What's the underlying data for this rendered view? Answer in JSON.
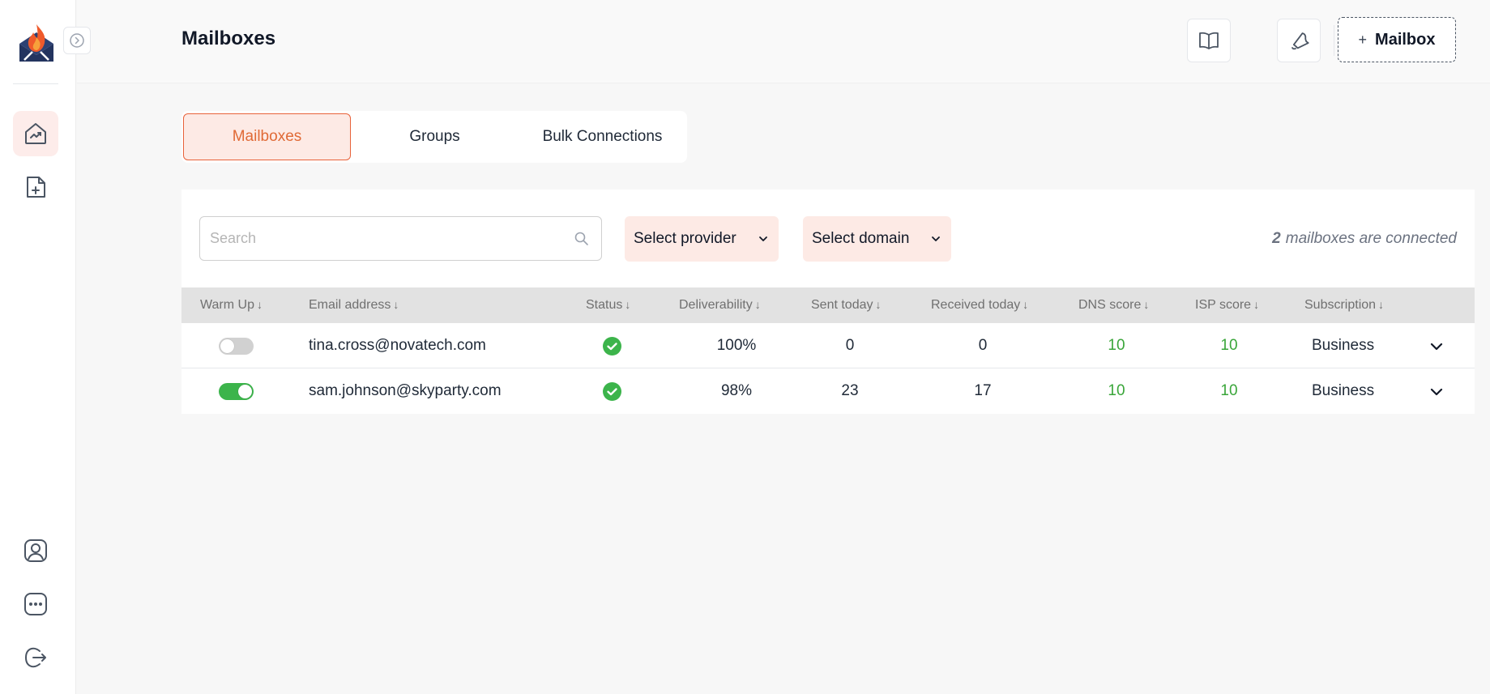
{
  "header": {
    "title": "Mailboxes",
    "add_mailbox_label": "Mailbox",
    "add_mailbox_plus": "+"
  },
  "tabs": [
    {
      "label": "Mailboxes",
      "active": true
    },
    {
      "label": "Groups",
      "active": false
    },
    {
      "label": "Bulk Connections",
      "active": false
    }
  ],
  "filters": {
    "search_placeholder": "Search",
    "provider_label": "Select provider",
    "domain_label": "Select domain"
  },
  "connected": {
    "count": "2",
    "text": "mailboxes are connected"
  },
  "table": {
    "columns": [
      "Warm Up",
      "Email address",
      "Status",
      "Deliverability",
      "Sent today",
      "Received today",
      "DNS score",
      "ISP score",
      "Subscription"
    ],
    "sort_arrow": "↓",
    "rows": [
      {
        "warm_up": false,
        "email": "tina.cross@novatech.com",
        "status": "ok",
        "deliverability": "100%",
        "sent_today": "0",
        "received_today": "0",
        "dns_score": "10",
        "isp_score": "10",
        "subscription": "Business"
      },
      {
        "warm_up": true,
        "email": "sam.johnson@skyparty.com",
        "status": "ok",
        "deliverability": "98%",
        "sent_today": "23",
        "received_today": "17",
        "dns_score": "10",
        "isp_score": "10",
        "subscription": "Business"
      }
    ]
  },
  "colors": {
    "accent": "#e8623a",
    "accent_bg": "#fdeae5",
    "success": "#3cb44b",
    "navy": "#23345f"
  },
  "icons": {
    "logo": "flame-envelope-logo",
    "collapse": "chevron-right-icon",
    "nav": [
      "chart-home-icon",
      "add-document-icon"
    ],
    "bottom": [
      "user-profile-icon",
      "more-dots-icon",
      "logout-icon"
    ],
    "header": [
      "book-icon",
      "bell-icon"
    ]
  }
}
